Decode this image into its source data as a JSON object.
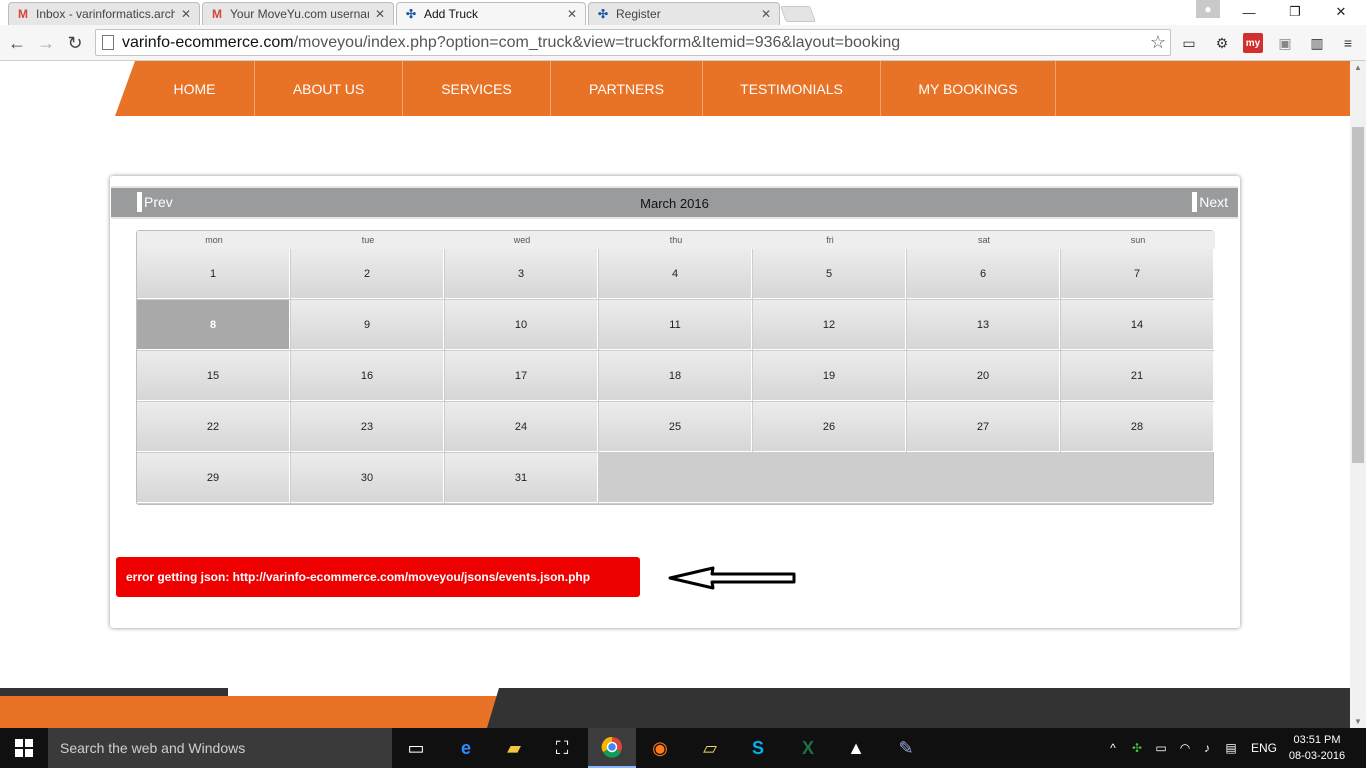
{
  "browser": {
    "tabs": [
      {
        "title": "Inbox - varinformatics.arch",
        "icon": "gmail-icon"
      },
      {
        "title": "Your MoveYu.com usernar",
        "icon": "gmail-icon"
      },
      {
        "title": "Add Truck",
        "icon": "joomla-icon"
      },
      {
        "title": "Register",
        "icon": "joomla-icon"
      }
    ],
    "url_host": "varinfo-ecommerce.com",
    "url_path": "/moveyou/index.php?option=com_truck&view=truckform&Itemid=936&layout=booking"
  },
  "nav": {
    "items": [
      "HOME",
      "ABOUT US",
      "SERVICES",
      "PARTNERS",
      "TESTIMONIALS",
      "MY BOOKINGS"
    ],
    "color": "#e87225"
  },
  "calendar": {
    "prev_label": "Prev",
    "next_label": "Next",
    "month_label": "March 2016",
    "weekdays": [
      "mon",
      "tue",
      "wed",
      "thu",
      "fri",
      "sat",
      "sun"
    ],
    "days": [
      "1",
      "2",
      "3",
      "4",
      "5",
      "6",
      "7",
      "8",
      "9",
      "10",
      "11",
      "12",
      "13",
      "14",
      "15",
      "16",
      "17",
      "18",
      "19",
      "20",
      "21",
      "22",
      "23",
      "24",
      "25",
      "26",
      "27",
      "28",
      "29",
      "30",
      "31"
    ],
    "today": "8"
  },
  "error": {
    "message": "error getting json: http://varinfo-ecommerce.com/moveyou/jsons/events.json.php",
    "color": "#ee0000"
  },
  "taskbar": {
    "search_placeholder": "Search the web and Windows",
    "language": "ENG",
    "time": "03:51 PM",
    "date": "08-03-2016"
  }
}
